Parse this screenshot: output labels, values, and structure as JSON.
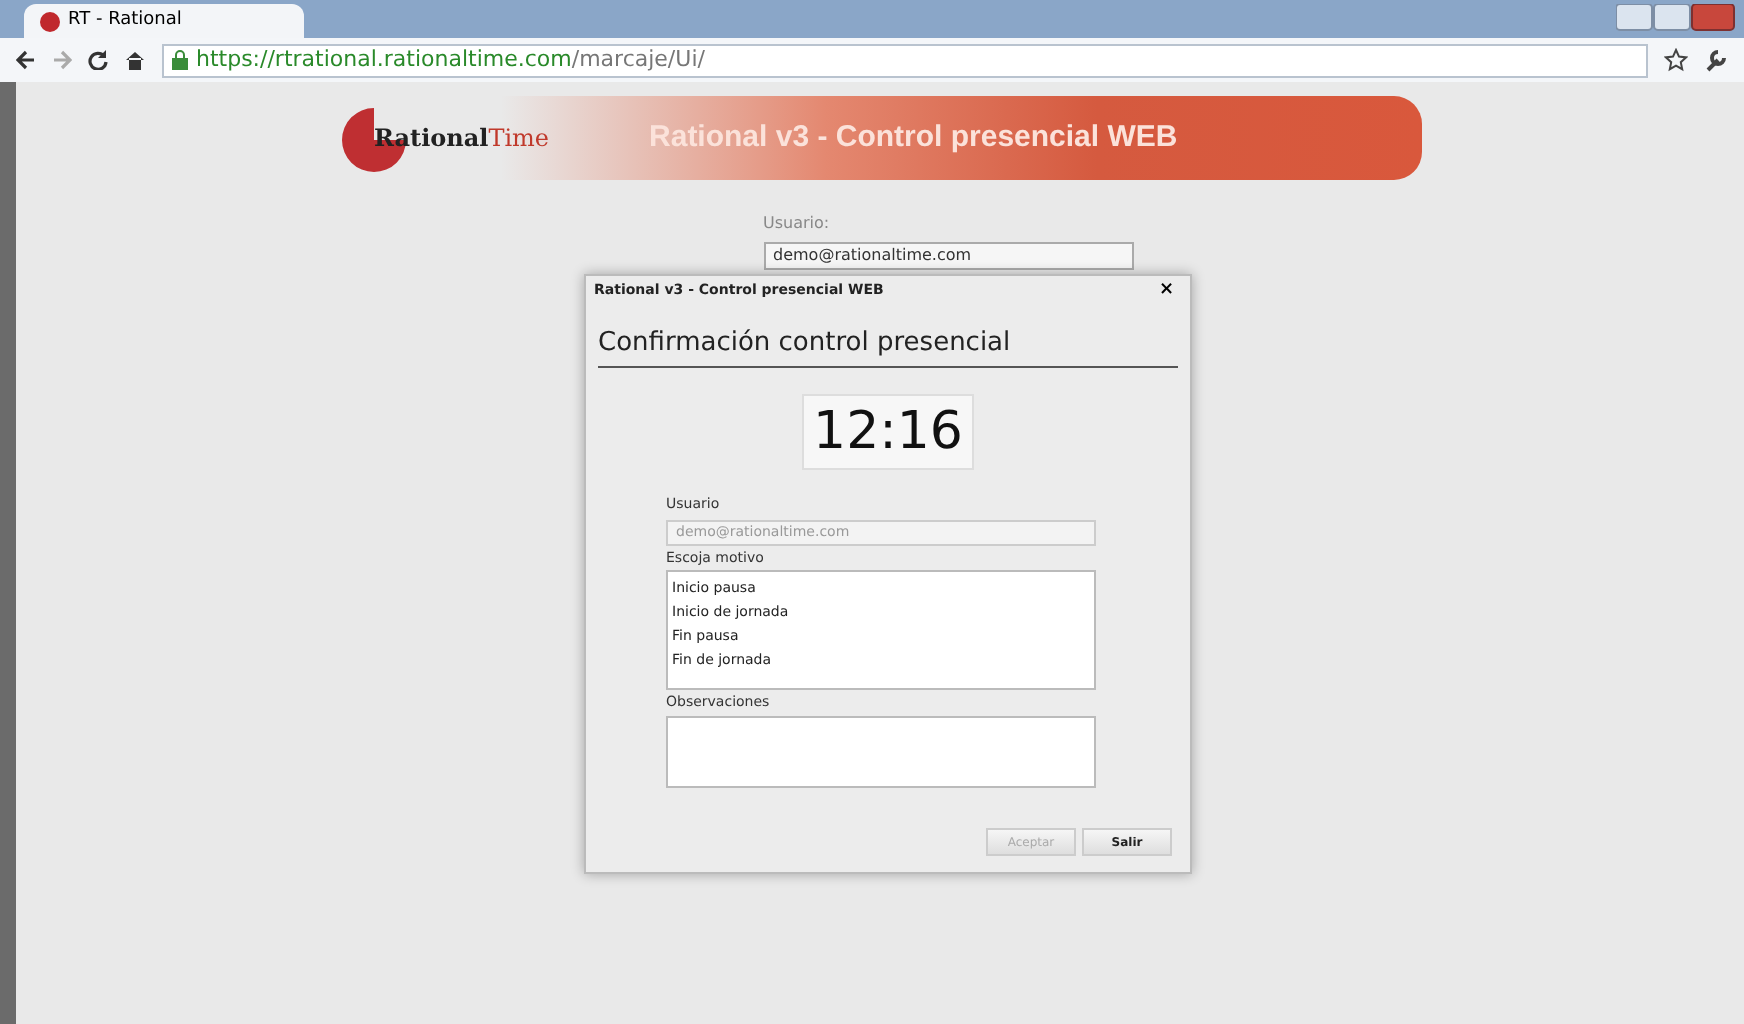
{
  "browser": {
    "tab_title": "RT - Rational",
    "url_host": "https://rtrational.rationaltime.com",
    "url_path": "/marcaje/Ui/"
  },
  "banner": {
    "logo_bold": "Rational",
    "logo_light": "Time",
    "title": "Rational v3 - Control presencial WEB"
  },
  "login": {
    "user_label": "Usuario:",
    "user_value": "demo@rationaltime.com"
  },
  "dialog": {
    "title": "Rational v3 - Control presencial WEB",
    "close": "×",
    "heading": "Confirmación control presencial",
    "time": "12:16",
    "user_label": "Usuario",
    "user_value": "demo@rationaltime.com",
    "user_disabled": true,
    "reason_label": "Escoja motivo",
    "reasons": [
      {
        "label": "Inicio pausa",
        "selected": false
      },
      {
        "label": "Inicio de jornada",
        "selected": false
      },
      {
        "label": "Fin pausa",
        "selected": false
      },
      {
        "label": "Fin de jornada",
        "selected": false
      }
    ],
    "notes_label": "Observaciones",
    "buttons": [
      {
        "label": "Aceptar",
        "disabled": true
      },
      {
        "label": "Salir",
        "disabled": false
      }
    ]
  }
}
